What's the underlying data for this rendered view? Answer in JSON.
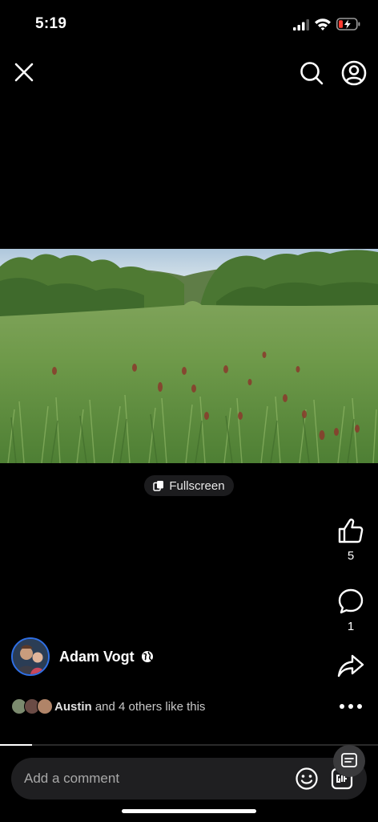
{
  "status_bar": {
    "time": "5:19",
    "icons": [
      "signal-icon",
      "wifi-icon",
      "battery-charging-icon"
    ],
    "battery_color": "#ff3b30"
  },
  "top_bar": {
    "icons": [
      "close-icon",
      "search-icon",
      "profile-icon"
    ]
  },
  "media": {
    "kind": "photo",
    "fullscreen_label": "Fullscreen"
  },
  "actions": {
    "like_count": "5",
    "comment_count": "1",
    "icons": [
      "thumbs-up-icon",
      "comment-icon",
      "share-icon",
      "more-icon"
    ]
  },
  "author": {
    "name": "Adam Vogt",
    "accent": "#2f6fe4"
  },
  "likes_summary": {
    "liker": "Austin",
    "rest": " and 4 others like this"
  },
  "video": {
    "progress": 0.085
  },
  "comment_box": {
    "placeholder": "Add a comment"
  }
}
